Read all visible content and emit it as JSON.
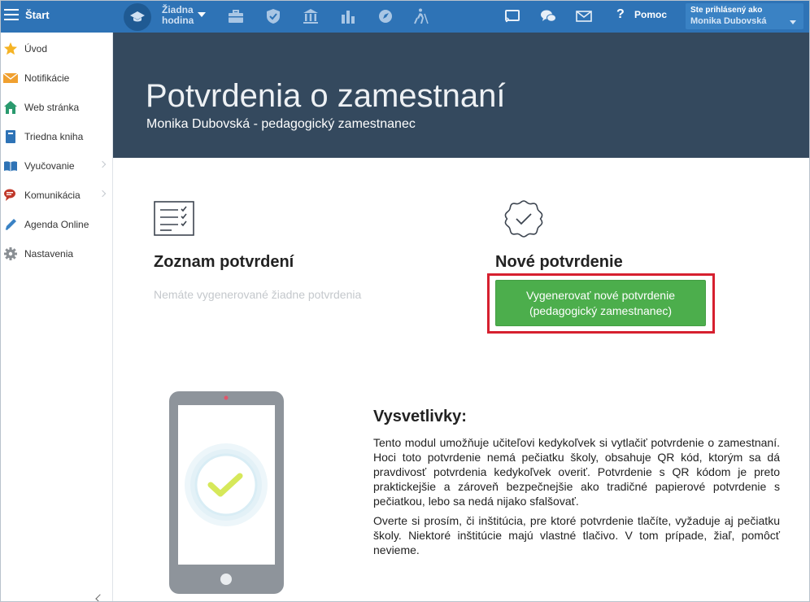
{
  "topbar": {
    "start_label": "Štart",
    "lesson_line1": "Žiadna",
    "lesson_line2": "hodina",
    "help_label": "Pomoc",
    "user_caption": "Ste prihlásený ako",
    "user_name": "Monika Dubovská",
    "icons": [
      "graduation-cap-icon",
      "briefcase-icon",
      "shield-check-icon",
      "bank-icon",
      "bar-chart-icon",
      "compass-icon",
      "hiking-icon",
      "cast-icon",
      "chat-bubbles-icon",
      "envelope-icon",
      "help-icon"
    ]
  },
  "sidebar": {
    "items": [
      {
        "label": "Úvod",
        "icon": "star-icon",
        "color": "#f5b324"
      },
      {
        "label": "Notifikácie",
        "icon": "envelope-icon",
        "color": "#f0a030"
      },
      {
        "label": "Web stránka",
        "icon": "home-icon",
        "color": "#2a9a6e"
      },
      {
        "label": "Triedna kniha",
        "icon": "book-icon",
        "color": "#2e73b6"
      },
      {
        "label": "Vyučovanie",
        "icon": "open-book-icon",
        "color": "#2e73b6"
      },
      {
        "label": "Komunikácia",
        "icon": "chat-icon",
        "color": "#c0392b"
      },
      {
        "label": "Agenda Online",
        "icon": "pen-icon",
        "color": "#3a82c4"
      },
      {
        "label": "Nastavenia",
        "icon": "gear-icon",
        "color": "#8a8f94"
      }
    ]
  },
  "hero": {
    "title": "Potvrdenia o zamestnaní",
    "subtitle": "Monika Dubovská - pedagogický zamestnanec"
  },
  "list_section": {
    "title": "Zoznam potvrdení",
    "empty_text": "Nemáte vygenerované žiadne potvrdenia"
  },
  "new_section": {
    "title": "Nové potvrdenie",
    "button_line1": "Vygenerovať nové potvrdenie",
    "button_line2": "(pedagogický zamestnanec)"
  },
  "explanation": {
    "title": "Vysvetlivky:",
    "paragraph1": "Tento modul umožňuje učiteľovi kedykoľvek si vytlačiť potvrdenie o zamestnaní. Hoci toto potvrdenie nemá pečiatku školy, obsahuje QR kód, ktorým sa dá pravdivosť potvrdenia kedykoľvek overiť. Potvrdenie s QR kódom je preto praktickejšie a zároveň bezpečnejšie ako tradičné papierové potvrdenie s pečiatkou, lebo sa nedá nijako sfalšovať.",
    "paragraph2": "Overte si prosím, či inštitúcia, pre ktoré potvrdenie tlačíte, vyžaduje aj pečiatku školy. Niektoré inštitúcie majú vlastné tlačivo. V tom prípade, žiaľ, pomôcť nevieme."
  },
  "colors": {
    "topbar": "#2e73b6",
    "hero": "#34495e",
    "button": "#4cae4c",
    "highlight": "#d6202f"
  }
}
